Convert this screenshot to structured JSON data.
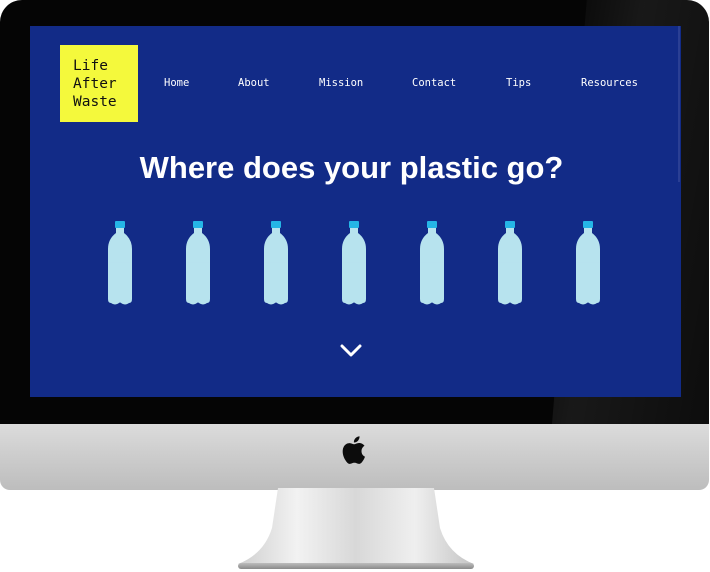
{
  "site": {
    "logo_lines": [
      "Life",
      "After",
      "Waste"
    ],
    "nav": [
      "Home",
      "About",
      "Mission",
      "Contact",
      "Tips",
      "Resources"
    ],
    "headline": "Where does your plastic go?",
    "bottle_count": 7,
    "scroll_icon": "chevron-down-icon"
  },
  "colors": {
    "page_bg": "#122b87",
    "logo_bg": "#f4f93c",
    "bottle_body": "#b7e3ee",
    "bottle_cap": "#25b6e6",
    "text": "#ffffff"
  },
  "device": {
    "type": "desktop-monitor",
    "emblem_icon": "apple-logo-icon"
  }
}
